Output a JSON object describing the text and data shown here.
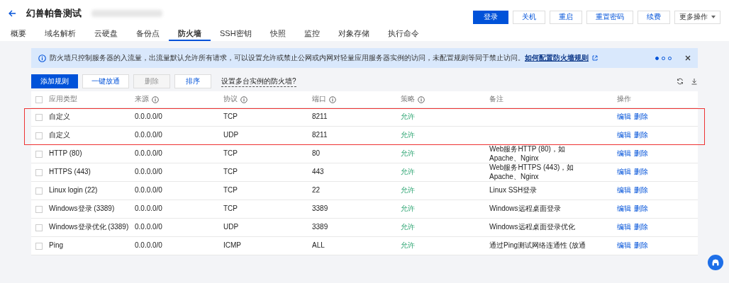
{
  "header": {
    "title": "幻兽帕鲁测试",
    "actions": [
      {
        "label": "登录",
        "kind": "primary"
      },
      {
        "label": "关机",
        "kind": "link"
      },
      {
        "label": "重启",
        "kind": "link"
      },
      {
        "label": "重置密码",
        "kind": "link"
      },
      {
        "label": "续费",
        "kind": "link"
      },
      {
        "label": "更多操作",
        "kind": "dropdown"
      }
    ]
  },
  "tabs": [
    {
      "label": "概要",
      "selected": false
    },
    {
      "label": "域名解析",
      "selected": false
    },
    {
      "label": "云硬盘",
      "selected": false
    },
    {
      "label": "备份点",
      "selected": false
    },
    {
      "label": "防火墙",
      "selected": true
    },
    {
      "label": "SSH密钥",
      "selected": false
    },
    {
      "label": "快照",
      "selected": false
    },
    {
      "label": "监控",
      "selected": false
    },
    {
      "label": "对象存储",
      "selected": false
    },
    {
      "label": "执行命令",
      "selected": false
    }
  ],
  "banner": {
    "text": "防火墙只控制服务器的入流量，出流量默认允许所有请求，可以设置允许或禁止公网或内网对轻量应用服务器实例的访问，未配置规则等同于禁止访问。",
    "link": "如何配置防火墙规则",
    "pages": [
      {
        "selected": true
      },
      {
        "selected": false
      },
      {
        "selected": false
      }
    ]
  },
  "toolbar": {
    "buttons": [
      {
        "label": "添加规则",
        "kind": "primary",
        "disabled": false
      },
      {
        "label": "一键放通",
        "kind": "default",
        "disabled": false
      },
      {
        "label": "删除",
        "kind": "default",
        "disabled": true
      },
      {
        "label": "排序",
        "kind": "default",
        "disabled": false
      }
    ],
    "help_link": "设置多台实例的防火墙?"
  },
  "table": {
    "select_all": false,
    "columns": [
      {
        "label": "应用类型",
        "info": false
      },
      {
        "label": "来源",
        "info": true
      },
      {
        "label": "协议",
        "info": true
      },
      {
        "label": "端口",
        "info": true
      },
      {
        "label": "策略",
        "info": true
      },
      {
        "label": "备注",
        "info": false
      },
      {
        "label": "操作",
        "info": false
      }
    ],
    "rows": [
      {
        "checked": false,
        "highlighted": true,
        "type": "自定义",
        "source": "0.0.0.0/0",
        "protocol": "TCP",
        "port": "8211",
        "policy": "允许",
        "note": "",
        "actions": [
          "编辑",
          "删除"
        ]
      },
      {
        "checked": false,
        "highlighted": true,
        "type": "自定义",
        "source": "0.0.0.0/0",
        "protocol": "UDP",
        "port": "8211",
        "policy": "允许",
        "note": "",
        "actions": [
          "编辑",
          "删除"
        ]
      },
      {
        "checked": false,
        "highlighted": false,
        "type": "HTTP (80)",
        "source": "0.0.0.0/0",
        "protocol": "TCP",
        "port": "80",
        "policy": "允许",
        "note": "Web服务HTTP (80)，如Apache、Nginx",
        "actions": [
          "编辑",
          "删除"
        ]
      },
      {
        "checked": false,
        "highlighted": false,
        "type": "HTTPS (443)",
        "source": "0.0.0.0/0",
        "protocol": "TCP",
        "port": "443",
        "policy": "允许",
        "note": "Web服务HTTPS (443)，如Apache、Nginx",
        "actions": [
          "编辑",
          "删除"
        ]
      },
      {
        "checked": false,
        "highlighted": false,
        "type": "Linux login (22)",
        "source": "0.0.0.0/0",
        "protocol": "TCP",
        "port": "22",
        "policy": "允许",
        "note": "Linux SSH登录",
        "actions": [
          "编辑",
          "删除"
        ]
      },
      {
        "checked": false,
        "highlighted": false,
        "type": "Windows登录 (3389)",
        "source": "0.0.0.0/0",
        "protocol": "TCP",
        "port": "3389",
        "policy": "允许",
        "note": "Windows远程桌面登录",
        "actions": [
          "编辑",
          "删除"
        ]
      },
      {
        "checked": false,
        "highlighted": false,
        "type": "Windows登录优化 (3389)",
        "source": "0.0.0.0/0",
        "protocol": "UDP",
        "port": "3389",
        "policy": "允许",
        "note": "Windows远程桌面登录优化",
        "actions": [
          "编辑",
          "删除"
        ]
      },
      {
        "checked": false,
        "highlighted": false,
        "type": "Ping",
        "source": "0.0.0.0/0",
        "protocol": "ICMP",
        "port": "ALL",
        "policy": "允许",
        "note": "通过Ping测试网络连通性 (放通",
        "actions": [
          "编辑",
          "删除"
        ]
      }
    ]
  }
}
